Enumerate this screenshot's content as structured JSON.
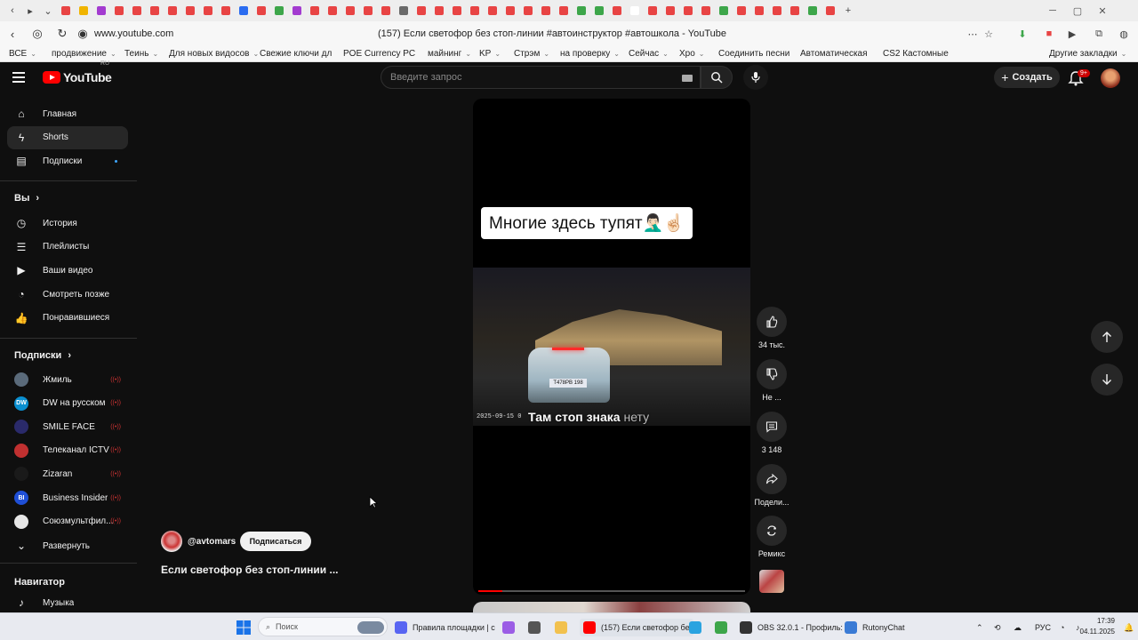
{
  "browser": {
    "tab_colors": [
      "#e84444",
      "#f0b400",
      "#a33bd0",
      "#e84444",
      "#e84444",
      "#e84444",
      "#e84444",
      "#e84444",
      "#e84444",
      "#e84444",
      "#2b6cf0",
      "#e84444",
      "#3da64a",
      "#a33bd0",
      "#e84444",
      "#e84444",
      "#e84444",
      "#e84444",
      "#e84444",
      "#6a6a6a",
      "#e84444",
      "#e84444",
      "#e84444",
      "#e84444",
      "#e84444",
      "#e84444",
      "#e84444",
      "#e84444",
      "#e84444",
      "#3da64a",
      "#3da64a",
      "#e84444",
      "#ffffff",
      "#e84444",
      "#e84444",
      "#e84444",
      "#e84444",
      "#3da64a",
      "#e84444",
      "#e84444",
      "#e84444",
      "#e84444",
      "#3da64a",
      "#e84444"
    ],
    "url": "www.youtube.com",
    "page_title": "(157) Если светофор без стоп-линии #автоинструктор #автошкола - YouTube"
  },
  "bookmarks": [
    {
      "label": "ВСЕ",
      "arrow": "⌄"
    },
    {
      "label": "продвижение",
      "arrow": "⌄"
    },
    {
      "label": "Теинь",
      "arrow": "⌄"
    },
    {
      "label": "Для новых видосов",
      "arrow": "⌄"
    },
    {
      "label": "Свежие ключи дл",
      "arrow": ""
    },
    {
      "label": "POE Currency PC",
      "arrow": ""
    },
    {
      "label": "майнинг",
      "arrow": "⌄"
    },
    {
      "label": "KP",
      "arrow": "⌄"
    },
    {
      "label": "Стрэм",
      "arrow": "⌄"
    },
    {
      "label": "на проверку",
      "arrow": "⌄"
    },
    {
      "label": "Сейчас",
      "arrow": "⌄"
    },
    {
      "label": "Хро",
      "arrow": "⌄"
    },
    {
      "label": "Соединить песни",
      "arrow": ""
    },
    {
      "label": "Автоматическая",
      "arrow": ""
    },
    {
      "label": "CS2 Кастомные",
      "arrow": ""
    },
    {
      "label": "Другие закладки",
      "arrow": "⌄"
    }
  ],
  "youtube": {
    "logo_text": "YouTube",
    "region": "RU",
    "search_placeholder": "Введите запрос",
    "create_label": "Создать",
    "notif_count": "9+"
  },
  "sidebar": {
    "main": [
      {
        "label": "Главная",
        "icon": "home-icon"
      },
      {
        "label": "Shorts",
        "icon": "shorts-icon"
      },
      {
        "label": "Подписки",
        "icon": "subscriptions-icon"
      }
    ],
    "you_header": "Вы",
    "you": [
      {
        "label": "История",
        "icon": "history-icon"
      },
      {
        "label": "Плейлисты",
        "icon": "playlists-icon"
      },
      {
        "label": "Ваши видео",
        "icon": "your-videos-icon"
      },
      {
        "label": "Смотреть позже",
        "icon": "watch-later-icon"
      },
      {
        "label": "Понравившиеся",
        "icon": "liked-icon"
      }
    ],
    "subs_header": "Подписки",
    "subs": [
      {
        "label": "Жмиль",
        "color": "#5a6a7a",
        "initial": ""
      },
      {
        "label": "DW на русском",
        "color": "#0a8fd0",
        "initial": "DW"
      },
      {
        "label": "SMILE FACE",
        "color": "#2a2a6a",
        "initial": ""
      },
      {
        "label": "Телеканал ICTV",
        "color": "#c03030",
        "initial": ""
      },
      {
        "label": "Zizaran",
        "color": "#1a1a1a",
        "initial": ""
      },
      {
        "label": "Business Insider",
        "color": "#1f4fd6",
        "initial": "BI"
      },
      {
        "label": "Союзмультфил...",
        "color": "#e6e6e6",
        "initial": ""
      }
    ],
    "expand_label": "Развернуть",
    "nav_header": "Навигатор",
    "nav": [
      {
        "label": "Музыка",
        "icon": "music-icon"
      }
    ],
    "live_mark": "((•))"
  },
  "short": {
    "caption_top": "Многие здесь тупят🤦🏻‍♂️☝🏻",
    "plate": "Т478РВ 198",
    "timestamp": "2025-09-15  0",
    "caption_sub_main": "Там стоп знака ",
    "caption_sub_dim": "нету",
    "progress": 0.09
  },
  "actions": {
    "likes": "34 тыс.",
    "dislike": "Не ...",
    "comments": "3 148",
    "share": "Подели...",
    "remix": "Ремикс"
  },
  "channel": {
    "handle": "@avtomars",
    "subscribe_label": "Подписаться",
    "title": "Если светофор без стоп-линии ..."
  },
  "taskbar": {
    "search_label": "Поиск",
    "apps": [
      {
        "label": "Правила площадки | c",
        "color": "#5865f2"
      },
      {
        "label": "",
        "color": "#9b5de5"
      },
      {
        "label": "",
        "color": "#555555"
      },
      {
        "label": "",
        "color": "#f2c14e"
      },
      {
        "label": "(157) Если светофор бе",
        "color": "#ff0000"
      },
      {
        "label": "",
        "color": "#2aa3e0"
      },
      {
        "label": "",
        "color": "#3da64a"
      },
      {
        "label": "OBS 32.0.1 - Профиль: F",
        "color": "#333333"
      },
      {
        "label": "RutonyChat",
        "color": "#3a7bd5"
      }
    ],
    "lang": "РУС",
    "time": "17:39",
    "date": "04.11.2025"
  }
}
